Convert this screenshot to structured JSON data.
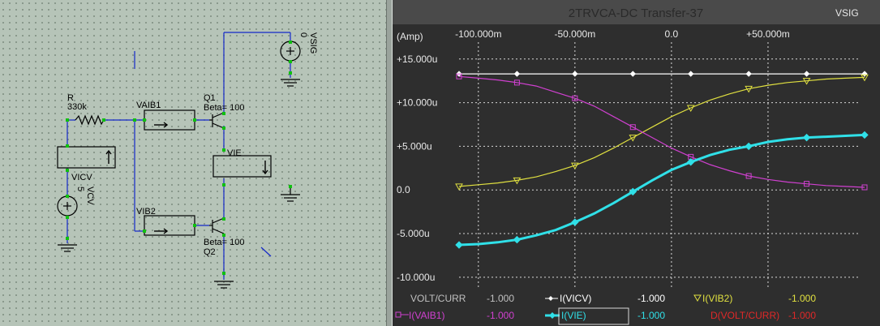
{
  "schematic": {
    "labels": {
      "r_name": "R",
      "r_value": "330k",
      "vaib1": "VAIB1",
      "vib2": "VIB2",
      "q1": "Q1",
      "q2": "Q2",
      "beta1": "Beta= 100",
      "beta2": "Beta= 100",
      "vie": "VIE",
      "vicv": "VICV",
      "vcv_name": "VCV",
      "vcv_value": "5",
      "vsig_name": "VSIG",
      "vsig_value": "0"
    }
  },
  "plot": {
    "title": "2TRVCA-DC Transfer-37",
    "sweep_label": "VSIG",
    "y_unit": "(Amp)",
    "x_ticks": [
      "-100.000m",
      "-50.000m",
      "0.0",
      "+50.000m"
    ],
    "y_ticks": [
      "+15.000u",
      "+10.000u",
      "+5.000u",
      "0.0",
      "-5.000u",
      "-10.000u"
    ],
    "legend": {
      "header": "VOLT/CURR",
      "header_value": "-1.000",
      "items": [
        {
          "label": "I(VICV)",
          "value": "-1.000"
        },
        {
          "label": "I(VIB2)",
          "value": "-1.000"
        },
        {
          "label": "I(VAIB1)",
          "value": "-1.000"
        },
        {
          "label": "I(VIE)",
          "value": "-1.000"
        },
        {
          "label": "D(VOLT/CURR)",
          "value": "-1.000"
        }
      ]
    }
  },
  "chart_data": {
    "type": "line",
    "title": "2TRVCA-DC Transfer-37",
    "xlabel": "VSIG",
    "ylabel": "(Amp)",
    "xlim": [
      -0.11,
      0.1
    ],
    "ylim": [
      -11.5,
      16
    ],
    "grid": true,
    "x": [
      -0.11,
      -0.1,
      -0.09,
      -0.08,
      -0.07,
      -0.06,
      -0.05,
      -0.04,
      -0.03,
      -0.02,
      -0.01,
      0.0,
      0.01,
      0.02,
      0.03,
      0.04,
      0.05,
      0.06,
      0.07,
      0.08,
      0.09,
      0.1
    ],
    "series": [
      {
        "name": "I(VICV)",
        "color": "#ffffff",
        "marker": "diamond",
        "values": [
          13.3,
          13.3,
          13.3,
          13.3,
          13.3,
          13.3,
          13.3,
          13.3,
          13.3,
          13.3,
          13.3,
          13.3,
          13.3,
          13.3,
          13.3,
          13.3,
          13.3,
          13.3,
          13.3,
          13.3,
          13.3,
          13.3
        ]
      },
      {
        "name": "I(VIB2)",
        "color": "#e0e040",
        "marker": "triangle-down",
        "values": [
          0.4,
          0.6,
          0.8,
          1.1,
          1.5,
          2.1,
          2.8,
          3.7,
          4.8,
          6.0,
          7.2,
          8.4,
          9.4,
          10.3,
          11.0,
          11.6,
          12.0,
          12.3,
          12.5,
          12.7,
          12.8,
          12.9
        ]
      },
      {
        "name": "I(VAIB1)",
        "color": "#d040d0",
        "marker": "square",
        "values": [
          13.0,
          12.8,
          12.6,
          12.3,
          11.9,
          11.2,
          10.5,
          9.6,
          8.4,
          7.2,
          6.0,
          4.8,
          3.8,
          2.9,
          2.2,
          1.6,
          1.2,
          0.9,
          0.7,
          0.5,
          0.4,
          0.3
        ]
      },
      {
        "name": "I(VIE)",
        "color": "#30e0e8",
        "marker": "diamond",
        "values": [
          -6.3,
          -6.2,
          -6.0,
          -5.7,
          -5.2,
          -4.6,
          -3.7,
          -2.7,
          -1.5,
          -0.2,
          1.1,
          2.3,
          3.2,
          4.0,
          4.6,
          5.0,
          5.5,
          5.8,
          6.0,
          6.1,
          6.2,
          6.3
        ]
      }
    ]
  }
}
